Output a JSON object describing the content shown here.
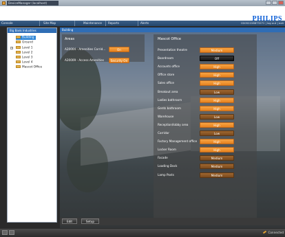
{
  "window": {
    "title": "DeviceManager (localhost)"
  },
  "brand": "PHILIPS",
  "tabs": [
    "Console",
    "Site Map",
    "Maintenance",
    "Reports",
    "Alerts"
  ],
  "user_info": "CD052228873271 | log out | exit",
  "sidebar": {
    "header": "Big Bank Industries",
    "items": [
      "Building",
      "Ground",
      "Level 1",
      "Level 2",
      "Level 3",
      "Level 4",
      "Mascot Office"
    ]
  },
  "main": {
    "header": "Building",
    "areas": {
      "title": "Areas",
      "rows": [
        {
          "label": "A20004 - Amenities Corrid...",
          "state": "On"
        },
        {
          "label": "A20009 - Access Amenities",
          "state": "Security On"
        }
      ]
    },
    "office": {
      "title": "Mascot Office",
      "rows": [
        {
          "label": "Presentation theatre",
          "state": "Medium",
          "style": "orange"
        },
        {
          "label": "Boardroom",
          "state": "Off",
          "style": "dark"
        },
        {
          "label": "Accounts office",
          "state": "High",
          "style": "orange"
        },
        {
          "label": "Office store",
          "state": "High",
          "style": "orange"
        },
        {
          "label": "Sales office",
          "state": "High",
          "style": "orange"
        },
        {
          "label": "Breakout area",
          "state": "Low",
          "style": "brown"
        },
        {
          "label": "Ladies bathroom",
          "state": "High",
          "style": "orange"
        },
        {
          "label": "Gents bathroom",
          "state": "High",
          "style": "orange"
        },
        {
          "label": "Warehouse",
          "state": "Low",
          "style": "brown"
        },
        {
          "label": "Reception/lobby area",
          "state": "High",
          "style": "orange"
        },
        {
          "label": "Corridor",
          "state": "Low",
          "style": "brown"
        },
        {
          "label": "Factory Management office",
          "state": "High",
          "style": "orange"
        },
        {
          "label": "Locker Room",
          "state": "High",
          "style": "orange"
        },
        {
          "label": "Facade",
          "state": "Medium",
          "style": "brown"
        },
        {
          "label": "Loading Dock",
          "state": "Medium",
          "style": "brown"
        },
        {
          "label": "Lamp Posts",
          "state": "Medium",
          "style": "brown"
        }
      ]
    }
  },
  "bottom_buttons": {
    "edit": "Edit",
    "setup": "Setup"
  },
  "status": {
    "connected": "Connected"
  }
}
